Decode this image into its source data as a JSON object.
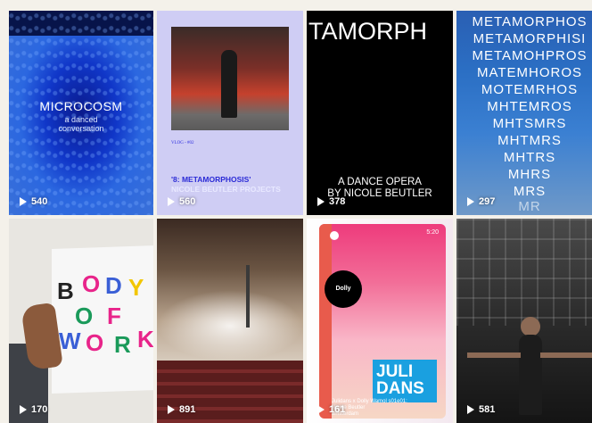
{
  "tiles": [
    {
      "views": "540",
      "title": "MICROCOSM",
      "subtitle_1": "a danced",
      "subtitle_2": "conversation"
    },
    {
      "views": "560",
      "vlog": "VLOG - #02",
      "title": "'8: METAMORPHOSIS'",
      "subtitle": "NICOLE BEUTLER PROJECTS"
    },
    {
      "views": "378",
      "title": "TAMORPH",
      "line_1": "A DANCE OPERA",
      "line_2": "BY NICOLE BEUTLER"
    },
    {
      "views": "297",
      "lines": [
        "METAMORPHOS",
        "METAMORPHISI",
        "METAMOHPROS",
        "MATEMHOROS",
        "MOTEMRHOS",
        "MHTEMROS",
        "MHTSMRS",
        "MHTMRS",
        "MHTRS",
        "MHRS",
        "MRS",
        "MR"
      ]
    },
    {
      "views": "170",
      "letters": [
        "B",
        "O",
        "D",
        "Y",
        "O",
        "F",
        "W",
        "O",
        "R",
        "K"
      ]
    },
    {
      "views": "891"
    },
    {
      "views": "161",
      "time": "5:20",
      "logo": "Dolly",
      "juli_1": "JULI",
      "juli_2": "DANS",
      "caption_1": "Julidans x Dolly Wamol s01e01:",
      "caption_2": "Nicole Beutler",
      "caption_3": "amsterdam"
    },
    {
      "views": "581"
    }
  ],
  "colors": {
    "background": "#f4f1ea",
    "t2_title": "#2b2bd6",
    "t7_pink": "#ee3b7c",
    "t7_blue": "#1aa0e0"
  },
  "icons": {
    "views": "play-icon"
  }
}
